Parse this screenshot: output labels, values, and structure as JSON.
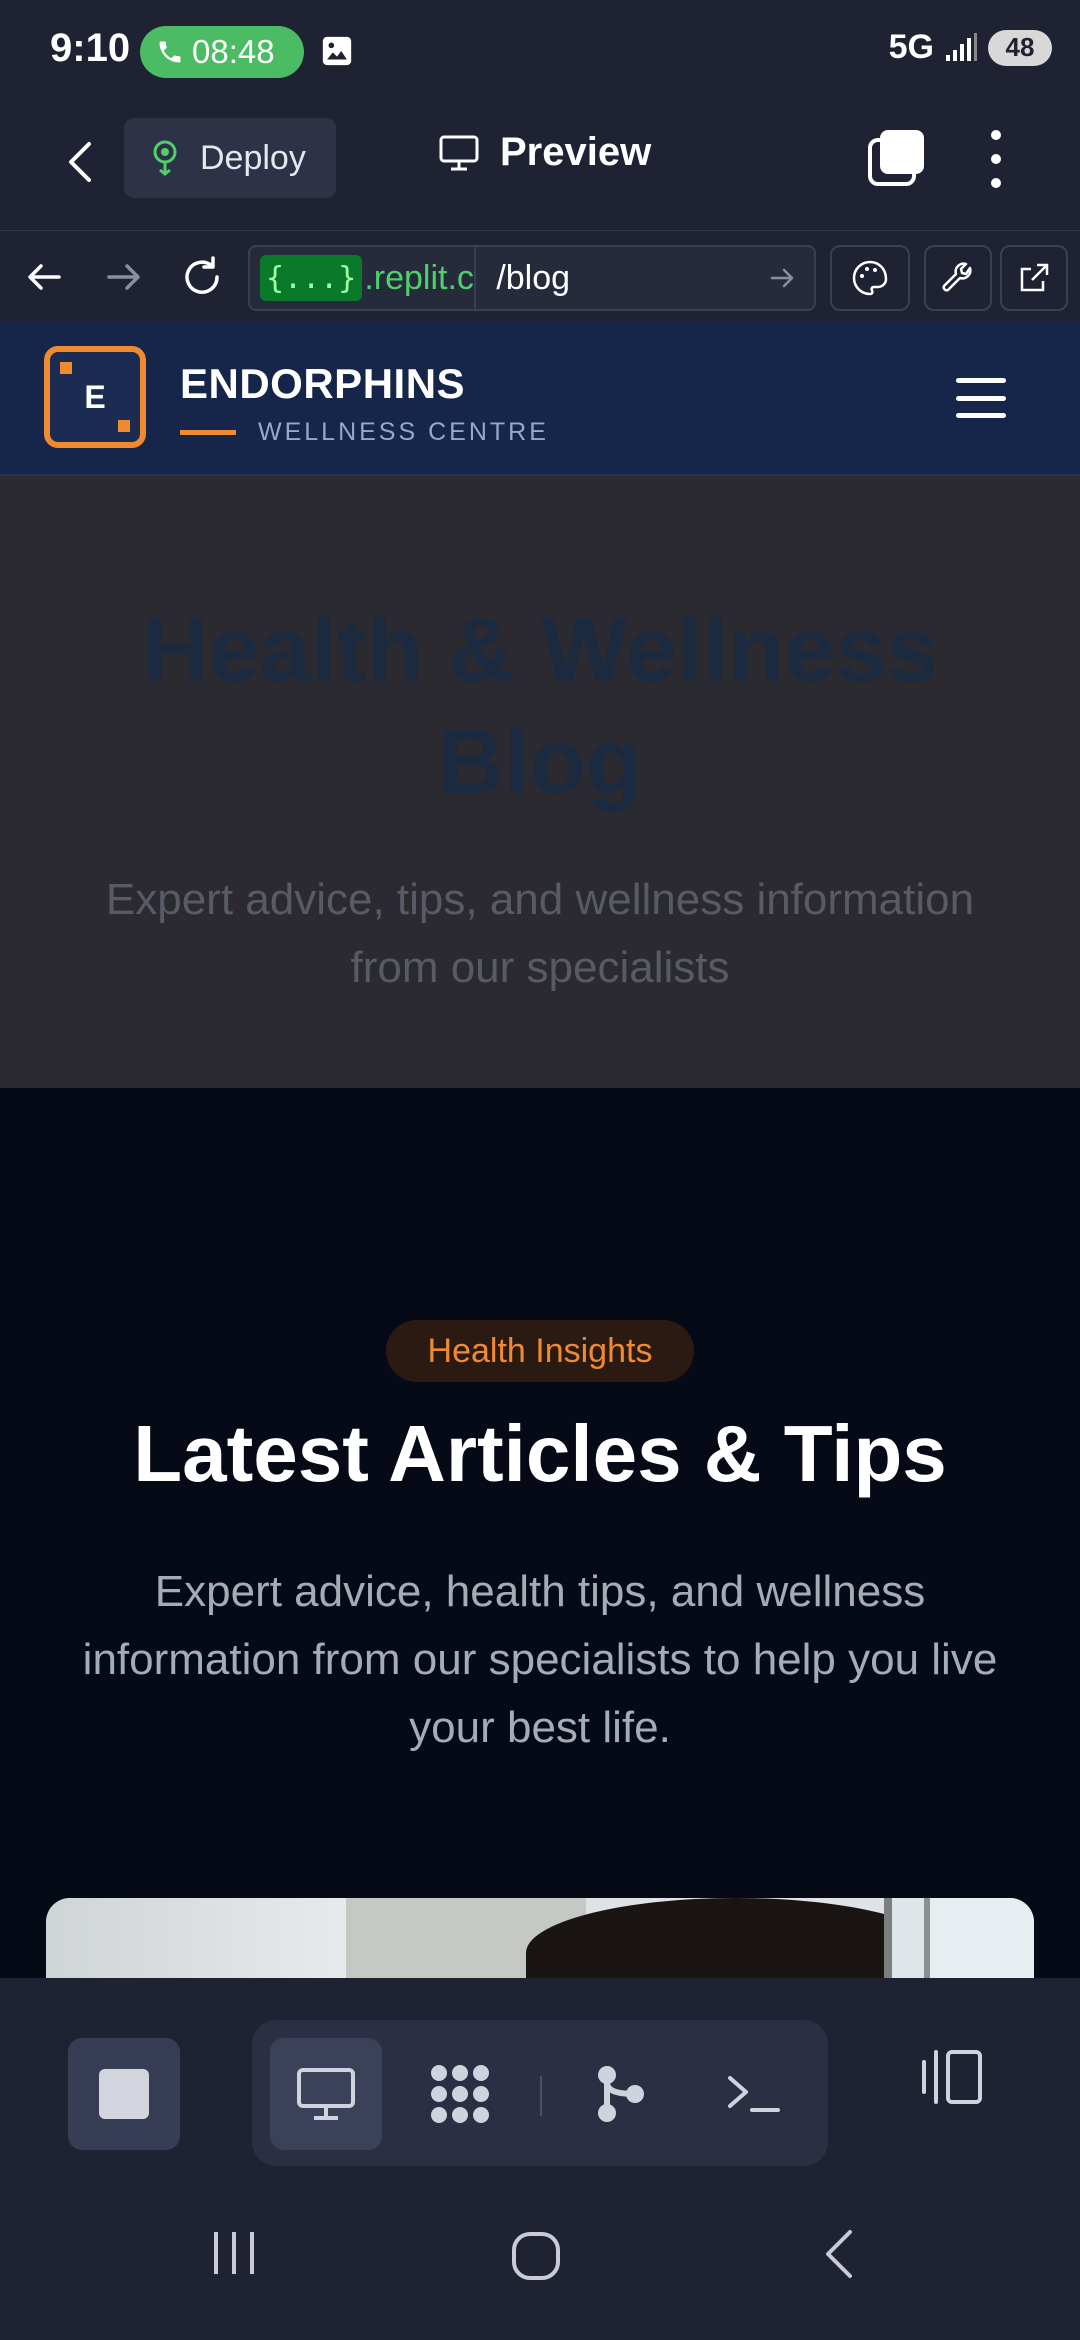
{
  "status_bar": {
    "time": "9:10",
    "call_timer": "08:48",
    "network": "5G",
    "battery": "48"
  },
  "app_bar": {
    "deploy_label": "Deploy",
    "title": "Preview"
  },
  "browser": {
    "url_chip": "{...}",
    "url_domain": ".replit.c",
    "url_path": "/blog"
  },
  "site": {
    "logo_letter": "E",
    "brand_name": "ENDORPHINS",
    "brand_sub": "WELLNESS CENTRE"
  },
  "hero": {
    "title": "Health & Wellness Blog",
    "subtitle": "Expert advice, tips, and wellness information from our specialists"
  },
  "articles": {
    "badge": "Health Insights",
    "title": "Latest Articles & Tips",
    "subtitle": "Expert advice, health tips, and wellness information from our specialists to help you live your best life."
  },
  "colors": {
    "accent": "#f08a30",
    "site_header_bg": "#16264a",
    "app_bg": "#1e2233",
    "url_green": "#4fd06a"
  },
  "icons": {
    "back": "chevron-left-icon",
    "deploy": "deploy-icon",
    "preview": "monitor-icon",
    "tabs": "tabs-icon",
    "more": "more-vertical-icon",
    "nav_back": "arrow-left-icon",
    "nav_forward": "arrow-right-icon",
    "reload": "reload-icon",
    "go": "arrow-right-icon",
    "theme": "palette-icon",
    "devtools": "wrench-icon",
    "open_external": "external-link-icon",
    "menu": "hamburger-icon",
    "stop": "stop-icon",
    "preview_tab": "monitor-icon",
    "workspace": "grid-icon",
    "git": "git-branch-icon",
    "shell": "terminal-icon",
    "layout": "sidebar-icon"
  }
}
